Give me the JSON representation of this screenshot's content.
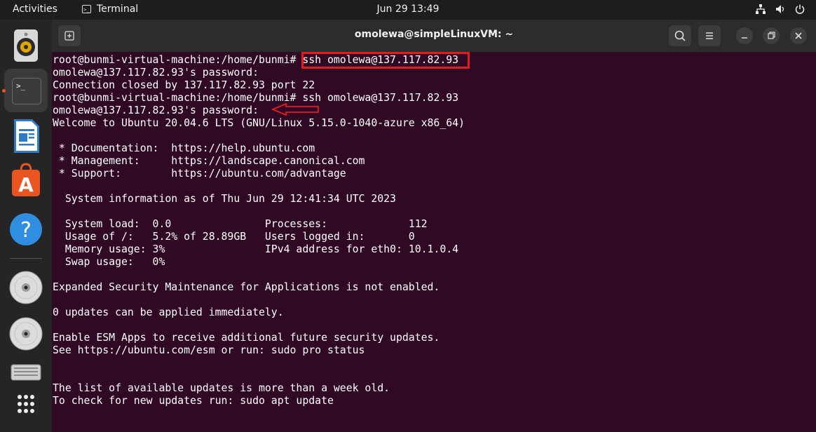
{
  "topbar": {
    "activities": "Activities",
    "app_name": "Terminal",
    "app_icon_glyph": ">_",
    "datetime": "Jun 29  13:49",
    "tray_icons": [
      "network-icon",
      "volume-icon",
      "power-icon"
    ]
  },
  "dock": {
    "items": [
      {
        "name": "rhythmbox",
        "icon": "speaker-icon"
      },
      {
        "name": "terminal",
        "icon": "terminal-icon",
        "glyph": ">_",
        "active": true
      },
      {
        "name": "libreoffice-writer",
        "icon": "document-icon"
      },
      {
        "name": "app-center",
        "icon": "shopping-bag-icon",
        "glyph": "A"
      },
      {
        "name": "help",
        "icon": "help-icon",
        "glyph": "?"
      },
      {
        "name": "disc-1",
        "icon": "disc-icon"
      },
      {
        "name": "disc-2",
        "icon": "disc-icon"
      },
      {
        "name": "files",
        "icon": "drive-icon"
      },
      {
        "name": "show-apps",
        "icon": "grid-icon"
      }
    ]
  },
  "window": {
    "title": "omolewa@simpleLinuxVM: ~",
    "buttons": [
      "new-tab-icon",
      "search-icon",
      "menu-icon",
      "minimize-icon",
      "maximize-icon",
      "close-icon"
    ]
  },
  "terminal": {
    "lines": [
      "root@bunmi-virtual-machine:/home/bunmi# ssh omolewa@137.117.82.93",
      "omolewa@137.117.82.93's password:",
      "Connection closed by 137.117.82.93 port 22",
      "root@bunmi-virtual-machine:/home/bunmi# ssh omolewa@137.117.82.93",
      "omolewa@137.117.82.93's password:",
      "Welcome to Ubuntu 20.04.6 LTS (GNU/Linux 5.15.0-1040-azure x86_64)",
      "",
      " * Documentation:  https://help.ubuntu.com",
      " * Management:     https://landscape.canonical.com",
      " * Support:        https://ubuntu.com/advantage",
      "",
      "  System information as of Thu Jun 29 12:41:34 UTC 2023",
      "",
      "  System load:  0.0               Processes:             112",
      "  Usage of /:   5.2% of 28.89GB   Users logged in:       0",
      "  Memory usage: 3%                IPv4 address for eth0: 10.1.0.4",
      "  Swap usage:   0%",
      "",
      "Expanded Security Maintenance for Applications is not enabled.",
      "",
      "0 updates can be applied immediately.",
      "",
      "Enable ESM Apps to receive additional future security updates.",
      "See https://ubuntu.com/esm or run: sudo pro status",
      "",
      "",
      "The list of available updates is more than a week old.",
      "To check for new updates run: sudo apt update"
    ],
    "highlighted_command": "ssh omolewa@137.117.82.93"
  },
  "colors": {
    "terminal_bg": "#300a24",
    "annotation_red": "#e31b23",
    "accent_orange": "#e95420"
  }
}
